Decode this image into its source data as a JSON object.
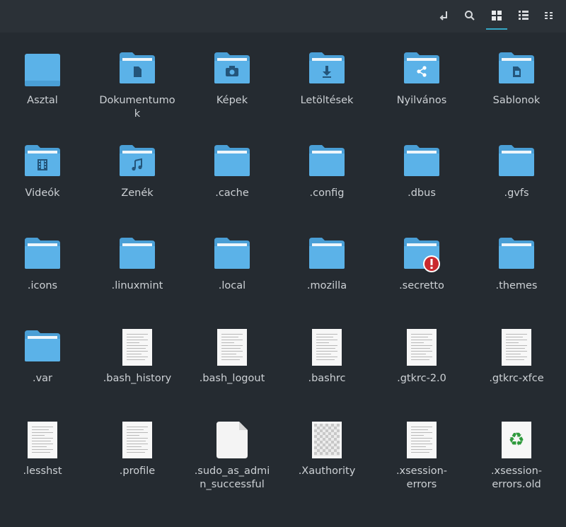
{
  "toolbar": {
    "buttons": [
      {
        "icon": "location-toggle-icon"
      },
      {
        "icon": "search-icon"
      },
      {
        "icon": "icon-view-icon",
        "active": true
      },
      {
        "icon": "list-view-icon"
      },
      {
        "icon": "compact-view-icon"
      }
    ]
  },
  "accent": "#35a7c5",
  "folder_color": "#5bb2e8",
  "items": [
    {
      "name": "Asztal",
      "type": "folder-plain"
    },
    {
      "name": "Dokumentumok",
      "type": "folder-document"
    },
    {
      "name": "Képek",
      "type": "folder-camera"
    },
    {
      "name": "Letöltések",
      "type": "folder-download"
    },
    {
      "name": "Nyilvános",
      "type": "folder-share"
    },
    {
      "name": "Sablonok",
      "type": "folder-template"
    },
    {
      "name": "Videók",
      "type": "folder-video"
    },
    {
      "name": "Zenék",
      "type": "folder-music"
    },
    {
      "name": ".cache",
      "type": "folder"
    },
    {
      "name": ".config",
      "type": "folder"
    },
    {
      "name": ".dbus",
      "type": "folder"
    },
    {
      "name": ".gvfs",
      "type": "folder"
    },
    {
      "name": ".icons",
      "type": "folder"
    },
    {
      "name": ".linuxmint",
      "type": "folder"
    },
    {
      "name": ".local",
      "type": "folder"
    },
    {
      "name": ".mozilla",
      "type": "folder"
    },
    {
      "name": ".secretto",
      "type": "folder-error"
    },
    {
      "name": ".themes",
      "type": "folder"
    },
    {
      "name": ".var",
      "type": "folder"
    },
    {
      "name": ".bash_history",
      "type": "text"
    },
    {
      "name": ".bash_logout",
      "type": "text"
    },
    {
      "name": ".bashrc",
      "type": "text"
    },
    {
      "name": ".gtkrc-2.0",
      "type": "text"
    },
    {
      "name": ".gtkrc-xfce",
      "type": "text"
    },
    {
      "name": ".lesshst",
      "type": "text"
    },
    {
      "name": ".profile",
      "type": "text"
    },
    {
      "name": ".sudo_as_admin_successful",
      "type": "empty"
    },
    {
      "name": ".Xauthority",
      "type": "checker"
    },
    {
      "name": ".xsession-errors",
      "type": "text"
    },
    {
      "name": ".xsession-errors.old",
      "type": "recycle"
    }
  ]
}
